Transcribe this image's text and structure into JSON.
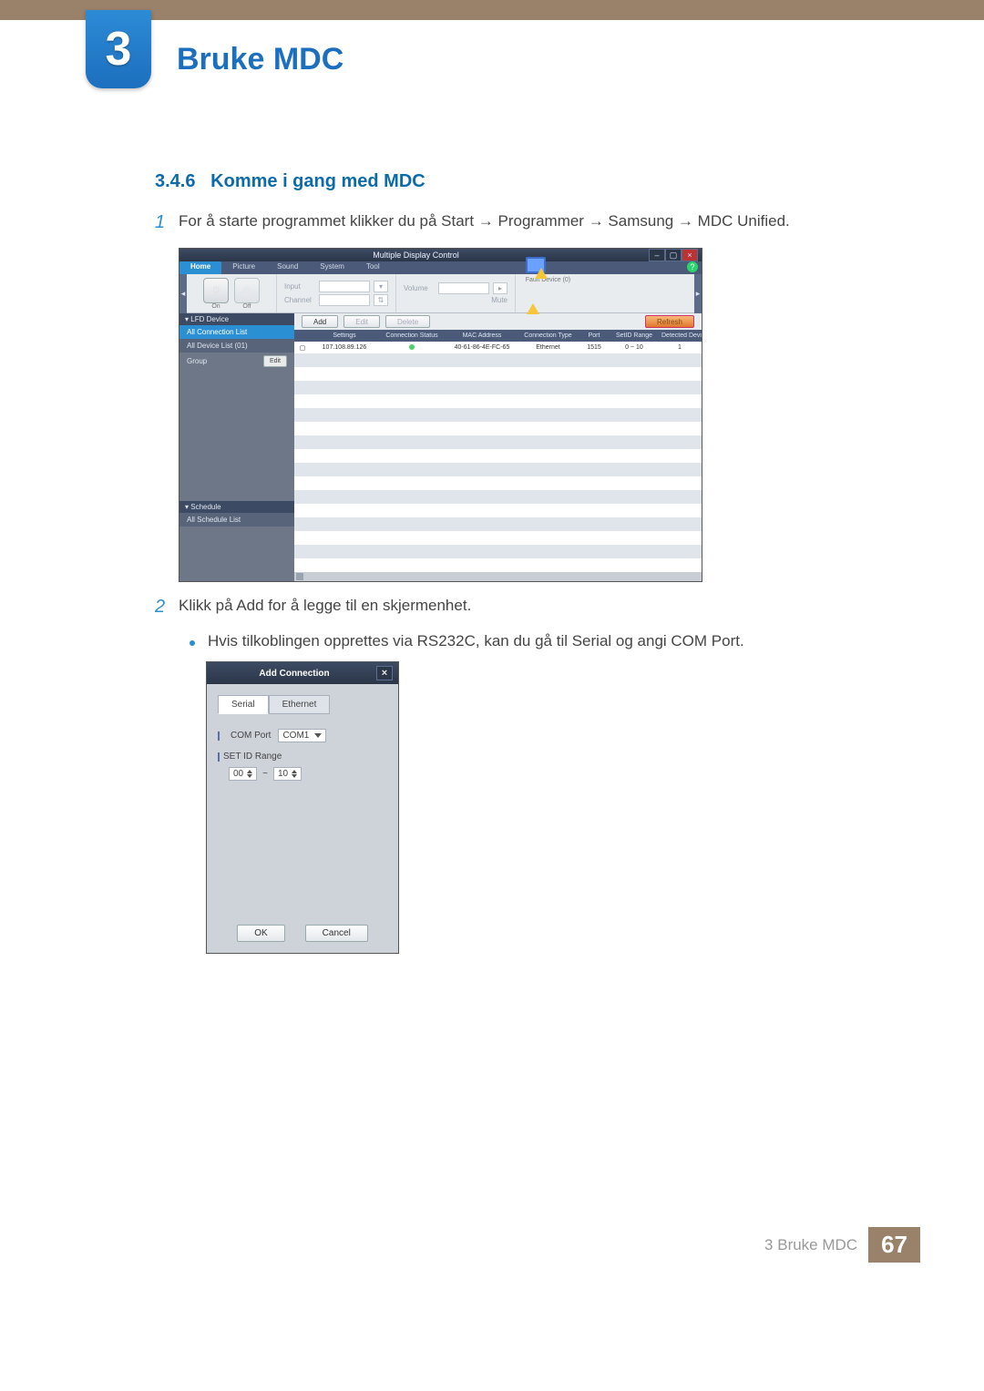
{
  "chapter": {
    "number": "3",
    "title": "Bruke MDC"
  },
  "section": {
    "number": "3.4.6",
    "title": "Komme i gang med MDC"
  },
  "step1": {
    "num": "1",
    "text": "For å starte programmet klikker du på Start → Programmer → Samsung → MDC Unified."
  },
  "step2": {
    "num": "2",
    "text": "Klikk på Add for å legge til en skjermenhet."
  },
  "bullet1": "Hvis tilkoblingen opprettes via RS232C, kan du gå til Serial og angi COM Port.",
  "mdc": {
    "title": "Multiple Display Control",
    "help": "?",
    "tabs": [
      "Home",
      "Picture",
      "Sound",
      "System",
      "Tool"
    ],
    "toolbar": {
      "on": "On",
      "off": "Off",
      "input": "Input",
      "channel": "Channel",
      "volume": "Volume",
      "mute": "Mute",
      "fd0": "Fault Device (0)",
      "fda": "Fault Device Alert"
    },
    "side": {
      "lfd": "LFD Device",
      "acl": "All Connection List",
      "adl": "All Device List (01)",
      "group": "Group",
      "edit": "Edit",
      "sched": "Schedule",
      "asl": "All Schedule List"
    },
    "buttons": {
      "add": "Add",
      "edit": "Edit",
      "delete": "Delete",
      "refresh": "Refresh"
    },
    "columns": [
      "",
      "Settings",
      "Connection Status",
      "MAC Address",
      "Connection Type",
      "Port",
      "SetID Range",
      "Detected Devices"
    ],
    "row": {
      "settings": "107.108.89.126",
      "mac": "40-61-86-4E-FC-65",
      "ctype": "Ethernet",
      "port": "1515",
      "range": "0 ~ 10",
      "detected": "1"
    }
  },
  "dlg": {
    "title": "Add Connection",
    "tabs": {
      "serial": "Serial",
      "ethernet": "Ethernet"
    },
    "com_label": "COM Port",
    "com_value": "COM1",
    "range_label": "SET ID Range",
    "r_from": "00",
    "tilde": "~",
    "r_to": "10",
    "ok": "OK",
    "cancel": "Cancel"
  },
  "footer": {
    "text": "3 Bruke MDC",
    "page": "67"
  }
}
